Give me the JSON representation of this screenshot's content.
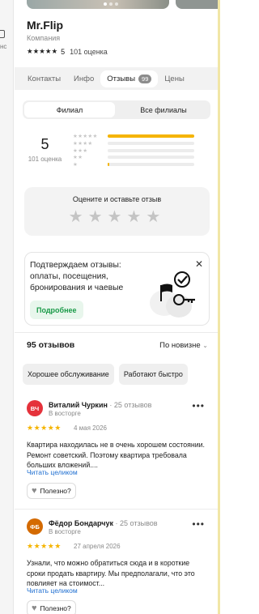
{
  "left_strip": {
    "label": "нс"
  },
  "business": {
    "name": "Mr.Flip",
    "category": "Компания",
    "rating_value": "5",
    "rating_count": "101 оценка"
  },
  "tabs": [
    {
      "label": "Контакты"
    },
    {
      "label": "Инфо"
    },
    {
      "label": "Отзывы",
      "badge": "99"
    },
    {
      "label": "Цены"
    }
  ],
  "branch_toggle": {
    "branch": "Филиал",
    "all": "Все филиалы"
  },
  "rating_summary": {
    "value": "5",
    "count": "101 оценка",
    "histogram": [
      {
        "stars": "★★★★★",
        "fraction": 1.0
      },
      {
        "stars": "★★★★",
        "fraction": 0.0
      },
      {
        "stars": "★★★",
        "fraction": 0.0
      },
      {
        "stars": "★★",
        "fraction": 0.0
      },
      {
        "stars": "★",
        "fraction": 0.01
      }
    ]
  },
  "rate_prompt": {
    "question": "Оцените и оставьте отзыв",
    "stars": "★★★★★"
  },
  "confirm_card": {
    "text": "Подтверждаем отзывы: оплаты, посещения, бронирования и чаевые",
    "button": "Подробнее"
  },
  "reviews_header": {
    "count_label": "95 отзывов",
    "sort_label": "По новизне"
  },
  "chips": [
    "Хорошее обслуживание",
    "Работают быстро"
  ],
  "reviews": [
    {
      "initials": "ВЧ",
      "avatar_color": "#e5323b",
      "name": "Виталий Чуркин",
      "meta": " · 25 отзывов",
      "status": "В восторге",
      "stars": "★★★★★",
      "date": "4 мая 2026",
      "text": "Квартира находилась не в очень хорошем состоянии. Ремонт советский. Поэтому квартира требовала больших вложений....",
      "read_more": "Читать целиком",
      "helpful": "Полезно?"
    },
    {
      "initials": "ФБ",
      "avatar_color": "#d46a00",
      "name": "Фёдор Бондарчук",
      "meta": " · 25 отзывов",
      "status": "В восторге",
      "stars": "★★★★★",
      "date": "27 апреля 2026",
      "text": "Узнали, что можно обратиться сюда и в короткие сроки продать квартиру. Мы предполагали, что это повлияет на стоимост...",
      "read_more": "Читать целиком",
      "helpful": "Полезно?"
    }
  ],
  "colors": {
    "accent_star": "#f5b400",
    "link": "#1f6fd1",
    "green": "#1a9a48"
  }
}
